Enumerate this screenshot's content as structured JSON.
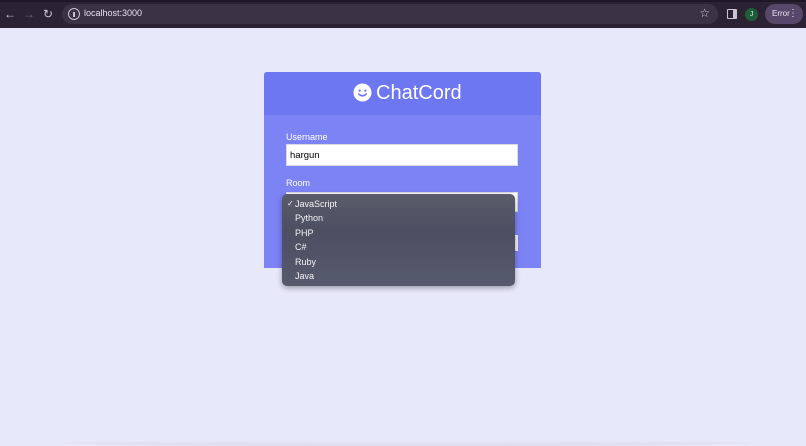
{
  "browser": {
    "url": "localhost:3000",
    "profile_initial": "J",
    "error_label": "Error",
    "icons": [
      "back-icon",
      "forward-icon",
      "reload-icon",
      "info-icon",
      "star-icon",
      "side-panel-icon",
      "menu-dots-icon"
    ]
  },
  "app": {
    "brand": "ChatCord",
    "username_label": "Username",
    "username_value": "hargun",
    "room_label": "Room",
    "colors": {
      "header": "#6e77f2",
      "card": "#7c83f5",
      "background": "#e8e8fb"
    }
  },
  "room_dropdown": {
    "selected": "JavaScript",
    "options": [
      {
        "label": "JavaScript",
        "check": "✓"
      },
      {
        "label": "Python"
      },
      {
        "label": "PHP"
      },
      {
        "label": "C#"
      },
      {
        "label": "Ruby"
      },
      {
        "label": "Java"
      }
    ]
  }
}
